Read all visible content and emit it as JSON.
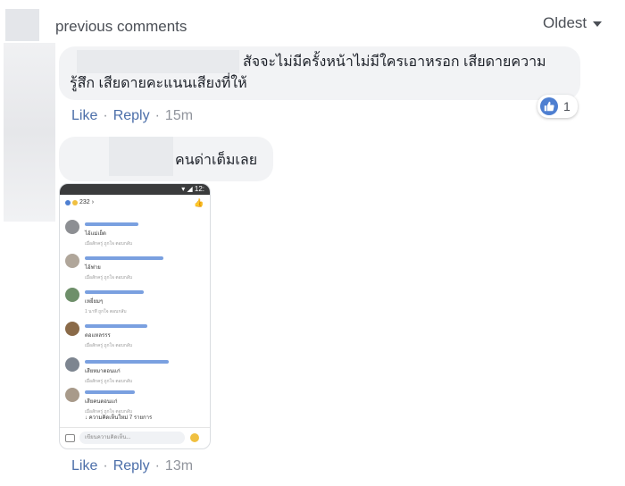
{
  "header": {
    "view_previous": "previous comments",
    "sort_label": "Oldest"
  },
  "comments": [
    {
      "text_line1": "สัจจะไม่มีครั้งหน้าไม่มีใครเอาหรอก เสียดายความ",
      "text_line2": "รู้สึก เสียดายคะแนนเสียงที่ให้",
      "like_label": "Like",
      "reply_label": "Reply",
      "time": "15m",
      "reaction_count": "1"
    },
    {
      "text": "คนด่าเต็มเลย",
      "like_label": "Like",
      "reply_label": "Reply",
      "time": "13m"
    }
  ],
  "phone_screenshot": {
    "reaction_count": "232",
    "comments": [
      {
        "text": "ไอ้แม่เย็ด",
        "meta": "เมื่อสักครู่  ถูกใจ  ตอบกลับ"
      },
      {
        "text": "ไอ้ฟาย",
        "meta": "เมื่อสักครู่  ถูกใจ  ตอบกลับ"
      },
      {
        "text": "เหยี่ยมๆ",
        "meta": "1 นาที  ถูกใจ  ตอบกลับ"
      },
      {
        "text": "ตอแหลรรร",
        "meta": "เมื่อสักครู่  ถูกใจ  ตอบกลับ"
      },
      {
        "text": "เสียหมาตอนแก่",
        "meta": "เมื่อสักครู่  ถูกใจ  ตอบกลับ"
      },
      {
        "text": "เสียคนตอนแก่",
        "meta": "เมื่อสักครู่  ถูกใจ  ตอบกลับ"
      }
    ],
    "more_replies": "↓ ความคิดเห็นใหม่ 7 รายการ",
    "input_placeholder": "เขียนความคิดเห็น..."
  }
}
